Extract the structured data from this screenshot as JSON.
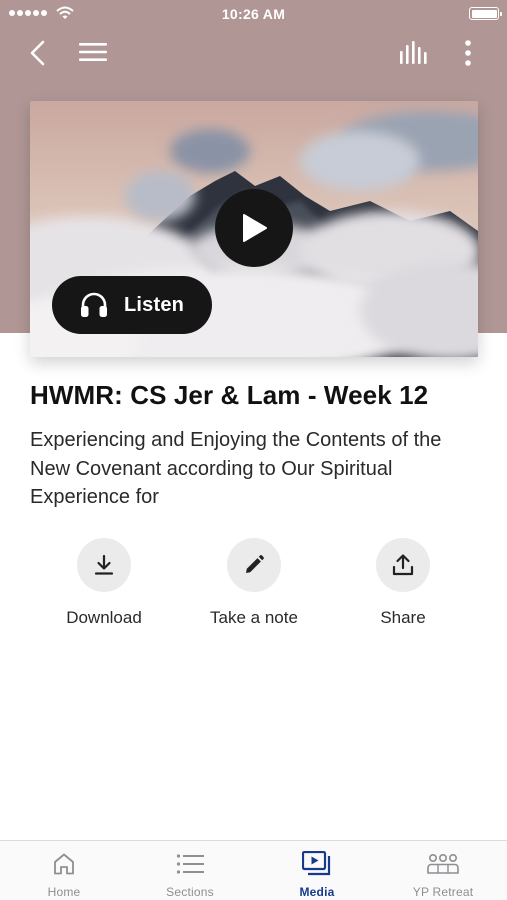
{
  "status_bar": {
    "time": "10:26 AM"
  },
  "nav": {
    "back_icon": "chevron-left-icon",
    "menu_icon": "hamburger-menu-icon",
    "stats_icon": "audio-bars-icon",
    "more_icon": "more-vertical-icon"
  },
  "player": {
    "listen_label": "Listen",
    "play_icon": "play-icon",
    "listen_icon": "headphones-icon"
  },
  "content": {
    "title": "HWMR: CS Jer & Lam - Week 12",
    "subtitle": "Experiencing and Enjoying the Contents of the New Covenant according to Our Spiritual Experience for"
  },
  "actions": [
    {
      "label": "Download",
      "icon": "download-icon"
    },
    {
      "label": "Take a note",
      "icon": "pencil-icon"
    },
    {
      "label": "Share",
      "icon": "share-icon"
    }
  ],
  "tabs": [
    {
      "label": "Home",
      "icon": "home-icon",
      "active": false
    },
    {
      "label": "Sections",
      "icon": "list-icon",
      "active": false
    },
    {
      "label": "Media",
      "icon": "media-icon",
      "active": true
    },
    {
      "label": "YP Retreat",
      "icon": "group-icon",
      "active": false
    }
  ],
  "colors": {
    "header_background": "#b09795",
    "active_tab": "#173b8c",
    "button_dark": "#161616",
    "action_circle": "#ebebeb"
  }
}
